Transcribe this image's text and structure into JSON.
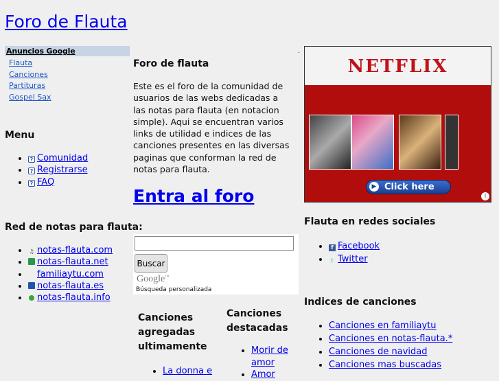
{
  "site": {
    "title": "Foro de Flauta"
  },
  "ads_sidebar": {
    "header": "Anuncios Google",
    "links": [
      "Flauta",
      "Canciones",
      "Partituras",
      "Gospel Sax"
    ]
  },
  "menu": {
    "title": "Menu",
    "items": [
      "Comunidad",
      "Registrarse",
      "FAQ"
    ]
  },
  "network": {
    "title": "Red de notas para flauta:",
    "items": [
      "notas-flauta.com",
      "notas-flauta.net",
      "familiaytu.com",
      "notas-flauta.es",
      "notas-flauta.info"
    ]
  },
  "intro": {
    "title": "Foro de flauta",
    "text": "Este es el foro de la comunidad de usuarios de las webs dedicadas a las notas para flauta (en notacion simple). Aqui se encuentran varios links de utilidad e indices de las canciones presentes en las diversas paginas que conforman la red de notas para flauta."
  },
  "enter_forum": {
    "label": "Entra al foro"
  },
  "search": {
    "value": "",
    "button_label": "Buscar",
    "logo_text": "Google",
    "logo_tm": "™",
    "caption": "Búsqueda personalizada"
  },
  "added_songs": {
    "title": "Canciones agregadas ultimamente",
    "items": [
      "La donna e"
    ]
  },
  "featured_songs": {
    "title": "Canciones destacadas",
    "items": [
      "Morir de amor",
      "Amor"
    ]
  },
  "netflix_ad": {
    "brand": "NETFLIX",
    "cta": "Click here",
    "adchoices": "i"
  },
  "dot_mark": ".",
  "social": {
    "title": "Flauta en redes sociales",
    "items": [
      "Facebook",
      "Twitter"
    ]
  },
  "indices": {
    "title": "Indices de canciones",
    "items": [
      "Canciones en familiaytu",
      "Canciones en notas-flauta.*",
      "Canciones de navidad",
      "Canciones mas buscadas"
    ]
  },
  "colors": {
    "link": "#0000ee",
    "ad_header": "#c6d4e4",
    "netflix_red": "#b20d0d",
    "page_bg": "#efefef"
  },
  "icons": {
    "menu": "question-icon",
    "network": [
      "music-note-icon",
      "notas-net-icon",
      "familia-icon",
      "notas-es-icon",
      "notas-info-icon"
    ],
    "social": [
      "facebook-icon",
      "twitter-icon"
    ]
  }
}
